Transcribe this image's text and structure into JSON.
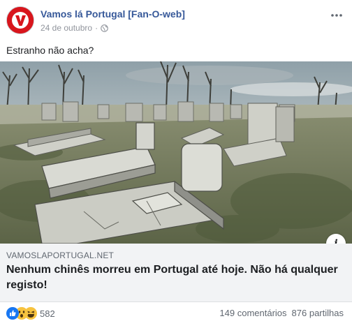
{
  "post": {
    "page_name": "Vamos lá Portugal [Fan-O-web]",
    "date": "24 de outubro",
    "separator": "·",
    "privacy_icon": "globe-icon",
    "text": "Estranho não acha?",
    "avatar_letter": "V",
    "colors": {
      "avatar_bg": "#d8151c",
      "link_blue": "#365899",
      "caption_bg": "#f2f3f5"
    }
  },
  "link": {
    "domain": "VAMOSLAPORTUGAL.NET",
    "title": "Nenhum chinês morreu em Portugal até hoje. Não há qualquer registo!",
    "image_icon": "cemetery-photo",
    "info_label": "i"
  },
  "footer": {
    "reaction_icons": [
      "like-icon",
      "wow-icon",
      "haha-icon"
    ],
    "reaction_count": "582",
    "comments": "149 comentários",
    "shares": "876 partilhas"
  }
}
